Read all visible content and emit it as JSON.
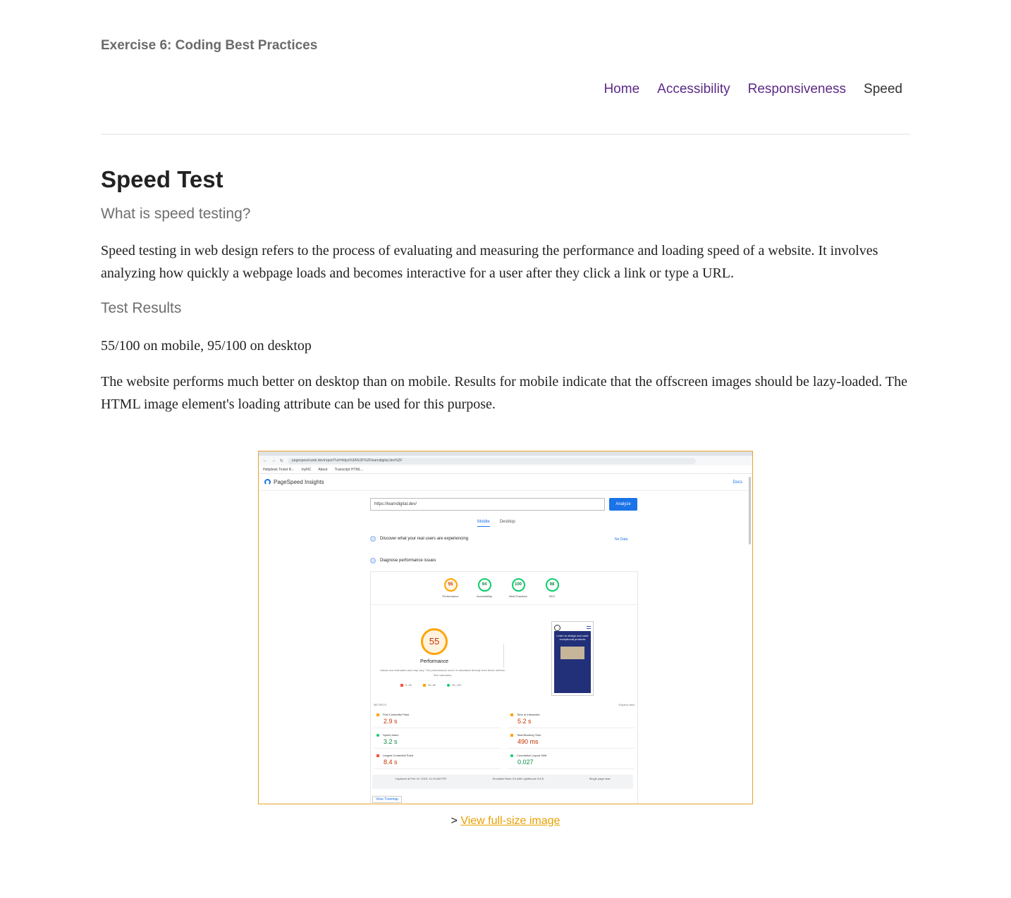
{
  "site": {
    "title": "Exercise 6: Coding Best Practices"
  },
  "nav": [
    {
      "label": "Home"
    },
    {
      "label": "Accessibility"
    },
    {
      "label": "Responsiveness"
    },
    {
      "label": "Speed"
    }
  ],
  "page": {
    "heading": "Speed Test",
    "sub1": "What is speed testing?",
    "intro": "Speed testing in web design refers to the process of evaluating and measuring the performance and loading speed of a website. It involves analyzing how quickly a webpage loads and becomes interactive for a user after they click a link or type a URL.",
    "sub2": "Test Results",
    "results": "55/100 on mobile, 95/100 on desktop",
    "summary": "The website performs much better on desktop than on mobile. Results for mobile indicate that the offscreen images should be lazy-loaded. The HTML image element's loading attribute can be used for this purpose."
  },
  "screenshot": {
    "url": "pagespeed.web.dev/report?url=https%3A%2F%2Flearndigital.dev%2F",
    "bookmarks": [
      "Helpdesk Ticket R...",
      "myNC",
      "About",
      "Transcript HTML..."
    ],
    "app_name": "PageSpeed Insights",
    "docs": "Docs",
    "input_value": "https://learndigital.dev/",
    "analyze": "Analyze",
    "tab_mobile": "Mobile",
    "tab_desktop": "Desktop",
    "discover": "Discover what your real users are experiencing",
    "no_data": "No Data",
    "diagnose": "Diagnose performance issues",
    "gauges": [
      {
        "score": "55",
        "label": "Performance"
      },
      {
        "score": "94",
        "label": "Accessibility"
      },
      {
        "score": "100",
        "label": "Best Practices"
      },
      {
        "score": "98",
        "label": "SEO"
      }
    ],
    "perf_score": "55",
    "perf_label": "Performance",
    "perf_note": "Values are estimated and may vary. The performance score is calculated directly from these metrics. See calculator.",
    "legend": [
      "0–49",
      "50–89",
      "90–100"
    ],
    "phone_text": "Learn to design and code exceptional products",
    "metrics_label": "METRICS",
    "expand_view": "Expand view",
    "metrics": [
      {
        "name": "First Contentful Paint",
        "value": "2.9 s"
      },
      {
        "name": "Time to Interactive",
        "value": "5.2 s"
      },
      {
        "name": "Speed Index",
        "value": "3.2 s"
      },
      {
        "name": "Total Blocking Time",
        "value": "490 ms"
      },
      {
        "name": "Largest Contentful Paint",
        "value": "8.4 s"
      },
      {
        "name": "Cumulative Layout Shift",
        "value": "0.027"
      }
    ],
    "footer": [
      "Captured at Feb 10, 2023, 11:15 AM PST",
      "Emulated Moto G4 with Lighthouse 9.6.8",
      "Single page load"
    ],
    "treemap": "View Treemap"
  },
  "caption": {
    "prefix": ">",
    "link": "View full-size image"
  }
}
